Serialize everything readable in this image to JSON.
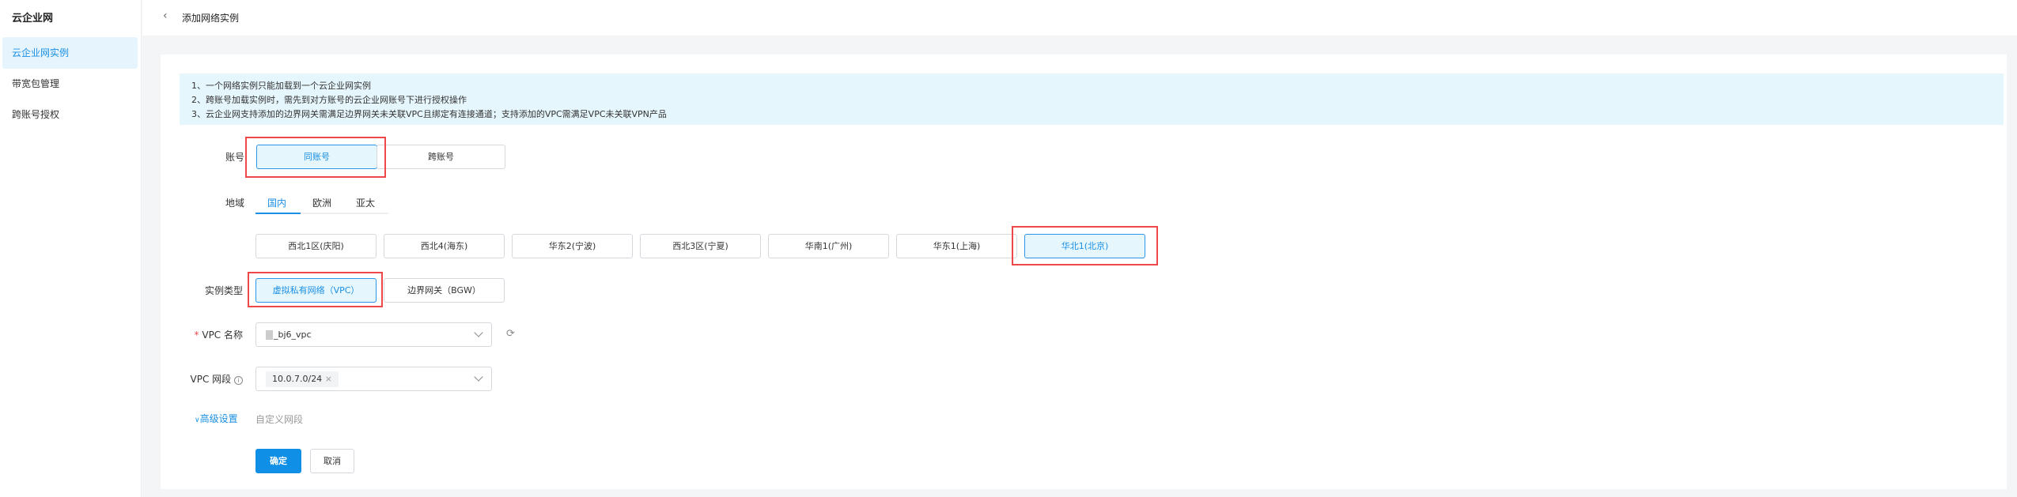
{
  "sidebar": {
    "title": "云企业网",
    "items": [
      {
        "label": "云企业网实例",
        "active": true
      },
      {
        "label": "带宽包管理"
      },
      {
        "label": "跨账号授权"
      }
    ]
  },
  "header": {
    "title": "添加网络实例",
    "back_icon": "chevron-left-icon"
  },
  "info": {
    "lines": [
      "1、一个网络实例只能加载到一个云企业网实例",
      "2、跨账号加载实例时，需先到对方账号的云企业网账号下进行授权操作",
      "3、云企业网支持添加的边界网关需满足边界网关未关联VPC且绑定有连接通道；支持添加的VPC需满足VPC未关联VPN产品"
    ]
  },
  "form": {
    "account": {
      "label": "账号",
      "options": [
        "同账号",
        "跨账号"
      ],
      "selected": "同账号"
    },
    "region": {
      "label": "地域",
      "tabs": [
        "国内",
        "欧洲",
        "亚太"
      ],
      "active_tab": "国内",
      "options": [
        "西北1区(庆阳)",
        "西北4(海东)",
        "华东2(宁波)",
        "西北3区(宁夏)",
        "华南1(广州)",
        "华东1(上海)",
        "华北1(北京)"
      ],
      "selected": "华北1(北京)"
    },
    "instance_type": {
      "label": "实例类型",
      "options": [
        "虚拟私有网络（VPC）",
        "边界网关（BGW）"
      ],
      "selected": "虚拟私有网络（VPC）"
    },
    "vpc_name": {
      "required": "*",
      "label": "VPC 名称",
      "value": "_bj6_vpc"
    },
    "vpc_cidr": {
      "label": "VPC 网段",
      "tag": "10.0.7.0/24"
    },
    "advanced": {
      "label": "高级设置",
      "hint": "自定义网段"
    },
    "confirm": "确定",
    "cancel": "取消"
  },
  "colors": {
    "accent": "#1a8fe3",
    "highlight": "#f04848",
    "info_bg": "#e6f6fd"
  }
}
